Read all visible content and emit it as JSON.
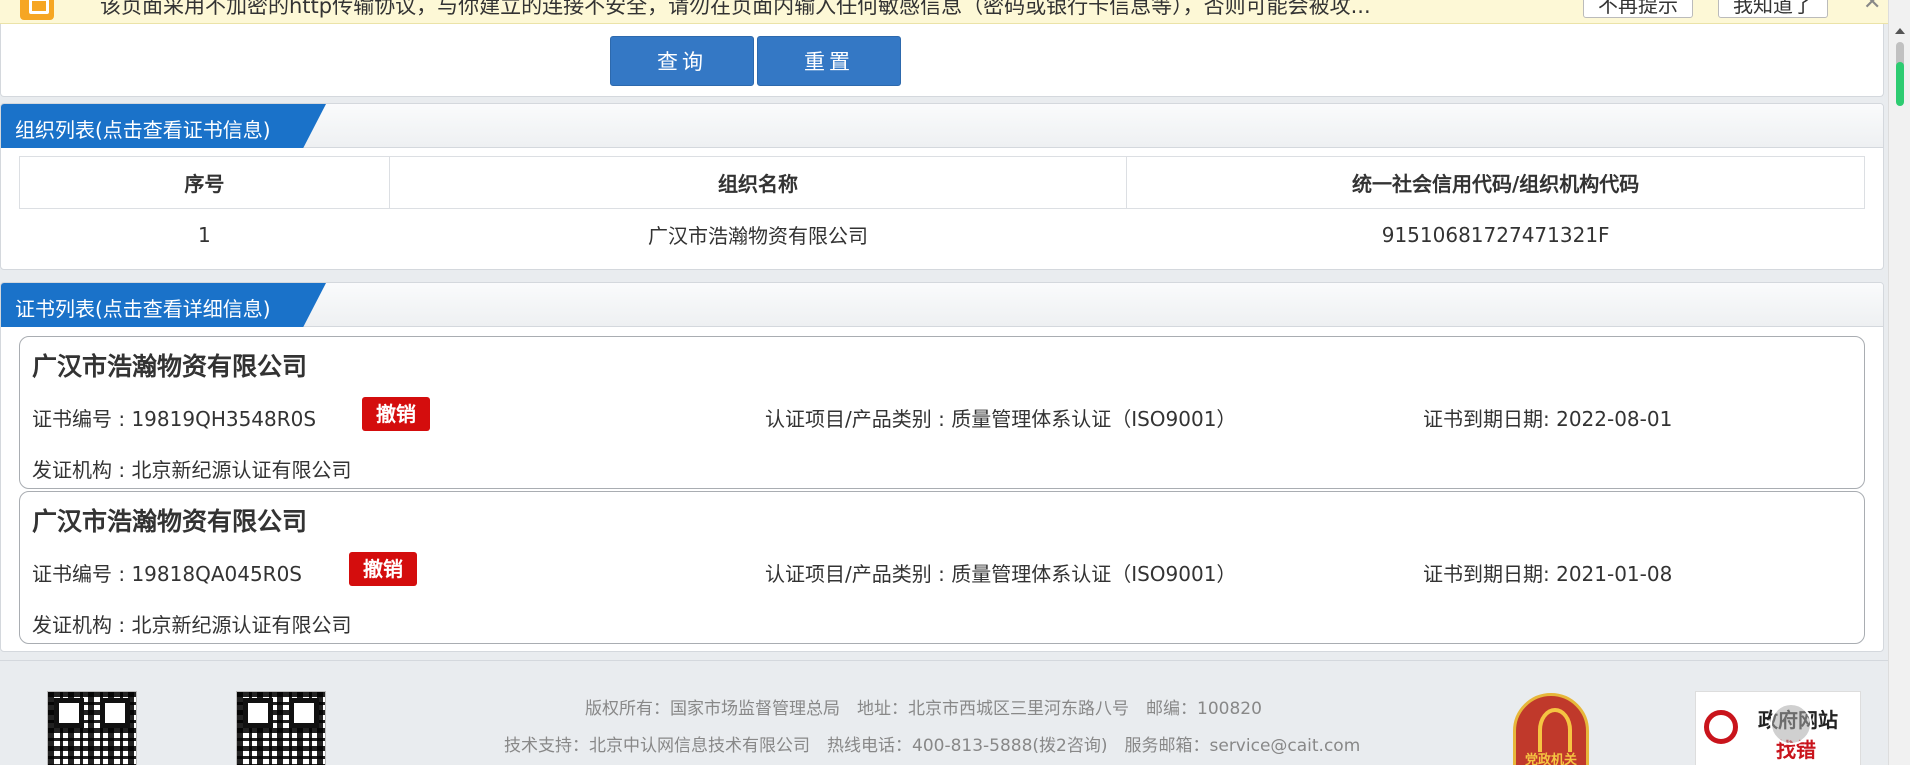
{
  "warning_bar": {
    "text": "该页面采用不加密的http传输协议，与你建立的连接不安全，请勿在页面内输入任何敏感信息（密码或银行卡信息等），否则可能会被攻...",
    "btn_no_remind": "不再提示",
    "btn_ok": "我知道了",
    "close": "✕"
  },
  "search": {
    "query_label": "查询",
    "reset_label": "重置"
  },
  "org_section": {
    "title": "组织列表(点击查看证书信息)",
    "columns": [
      "序号",
      "组织名称",
      "统一社会信用代码/组织机构代码"
    ],
    "rows": [
      {
        "index": "1",
        "name": "广汉市浩瀚物资有限公司",
        "code": "91510681727471321F"
      }
    ]
  },
  "cert_section": {
    "title": "证书列表(点击查看详细信息)",
    "certs": [
      {
        "org_name": "广汉市浩瀚物资有限公司",
        "cert_no": "证书编号 : 19819QH3548R0S",
        "status": "撤销",
        "category": "认证项目/产品类别 : 质量管理体系认证（ISO9001）",
        "expiry": "证书到期日期: 2022-08-01",
        "issuer": "发证机构 : 北京新纪源认证有限公司"
      },
      {
        "org_name": "广汉市浩瀚物资有限公司",
        "cert_no": "证书编号 : 19818QA045R0S",
        "status": "撤销",
        "category": "认证项目/产品类别 : 质量管理体系认证（ISO9001）",
        "expiry": "证书到期日期: 2021-01-08",
        "issuer": "发证机构 : 北京新纪源认证有限公司"
      }
    ]
  },
  "footer": {
    "line1": "版权所有：国家市场监督管理总局　地址：北京市西城区三里河东路八号　邮编：100820",
    "line2": "技术支持：北京中认网信息技术有限公司　热线电话：400-813-5888(拨2咨询)　服务邮箱：service@cait.com",
    "emblem_text": "党政机关",
    "jiucuo_line1": "政府网站",
    "jiucuo_line2": "找错"
  },
  "colors": {
    "primary_blue": "#1a72c9",
    "button_blue": "#3478c5",
    "revoked_red": "#d40d0d"
  }
}
